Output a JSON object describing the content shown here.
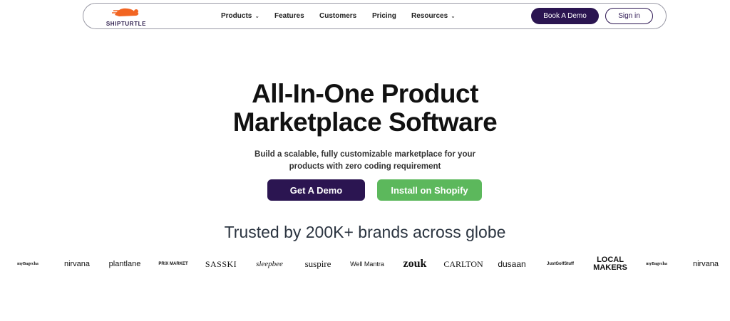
{
  "nav": {
    "logo_text": "SHIPTURTLE",
    "items": [
      {
        "label": "Products",
        "dropdown": true
      },
      {
        "label": "Features",
        "dropdown": false
      },
      {
        "label": "Customers",
        "dropdown": false
      },
      {
        "label": "Pricing",
        "dropdown": false
      },
      {
        "label": "Resources",
        "dropdown": true
      }
    ],
    "book_demo_label": "Book A Demo",
    "sign_in_label": "Sign in"
  },
  "hero": {
    "title_line1": "All-In-One Product",
    "title_line2": "Marketplace Software",
    "subtitle_line1": "Build a scalable, fully customizable marketplace for your",
    "subtitle_line2": "products with zero coding requirement",
    "cta_primary": "Get A Demo",
    "cta_secondary": "Install on Shopify"
  },
  "trusted": {
    "heading": "Trusted by 200K+ brands across globe"
  },
  "brands": [
    "myBagecha",
    "nirvana",
    "plantlane",
    "PRIX MARKET",
    "SASSKI",
    "sleepbee",
    "suspire",
    "Well Mantra",
    "zouk",
    "CARLTON",
    "dusaan",
    "JustGolfStuff",
    "LOCAL MAKERS",
    "myBagecha",
    "nirvana"
  ],
  "colors": {
    "brand_purple": "#2b1551",
    "shopify_green": "#5cb85c",
    "logo_orange": "#f26522"
  }
}
